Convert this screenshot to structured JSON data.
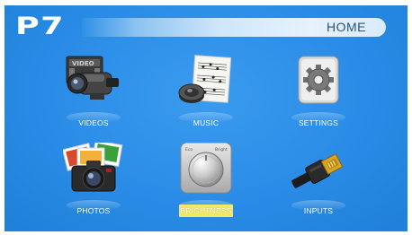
{
  "header": {
    "brand": "P7",
    "title": "HOME"
  },
  "menu": {
    "selected": "brightness",
    "items": [
      {
        "id": "videos",
        "label": "VIDEOS",
        "icon": "video-camera-icon"
      },
      {
        "id": "music",
        "label": "MUSIC",
        "icon": "music-sheet-speaker-icon"
      },
      {
        "id": "settings",
        "label": "SETTINGS",
        "icon": "gear-icon"
      },
      {
        "id": "photos",
        "label": "PHOTOS",
        "icon": "photo-camera-icon"
      },
      {
        "id": "brightness",
        "label": "BRIGHTNESS",
        "icon": "brightness-knob-icon",
        "knob_left": "Eco",
        "knob_right": "Bright"
      },
      {
        "id": "inputs",
        "label": "INPUTS",
        "icon": "hdmi-cable-icon"
      }
    ]
  },
  "colors": {
    "background": "#2b8ee6",
    "selection_highlight": "#f4e86a",
    "label_text": "#ffffff",
    "title_text": "#2a4f7a"
  }
}
